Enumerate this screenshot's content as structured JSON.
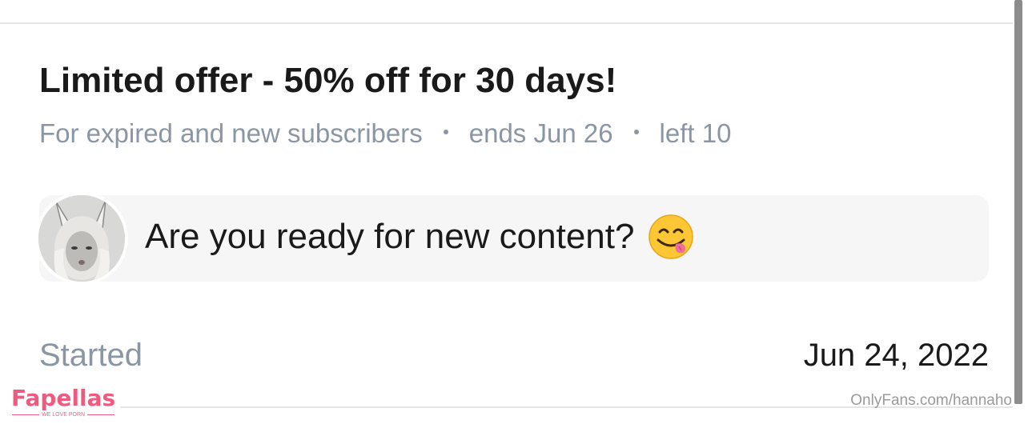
{
  "offer": {
    "title": "Limited offer - 50% off for 30 days!",
    "audience": "For expired and new subscribers",
    "ends": "ends Jun 26",
    "left": "left 10"
  },
  "message": {
    "text": "Are you ready for new content?",
    "emoji_icon": "face-savoring-food-icon"
  },
  "details": {
    "started_label": "Started",
    "started_value": "Jun 24, 2022"
  },
  "watermarks": {
    "brand": "Fapellas",
    "tagline": "WE LOVE PORN",
    "url": "OnlyFans.com/hannaho"
  },
  "colors": {
    "muted_text": "#8a96a3",
    "primary_text": "#1a1a1a",
    "bubble_bg": "#f6f6f6",
    "brand_pink": "#ef5b7e"
  }
}
